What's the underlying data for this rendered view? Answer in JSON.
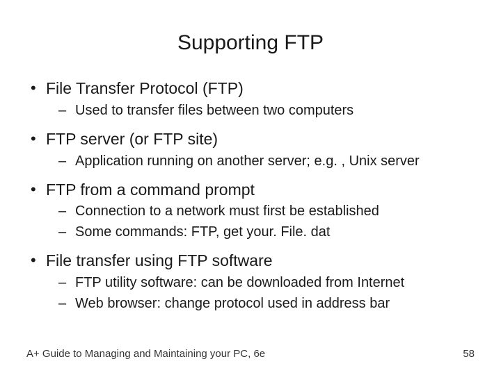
{
  "title": "Supporting FTP",
  "bullets": [
    {
      "text": "File Transfer Protocol (FTP)",
      "sub": [
        "Used to transfer files between two computers"
      ]
    },
    {
      "text": "FTP server (or FTP site)",
      "sub": [
        "Application running on another server; e.g. , Unix server"
      ]
    },
    {
      "text": "FTP from a command prompt",
      "sub": [
        "Connection to a network must first be established",
        "Some commands: FTP, get your. File. dat"
      ]
    },
    {
      "text": "File transfer using FTP software",
      "sub": [
        "FTP utility software: can be downloaded from Internet",
        "Web browser: change protocol used in address bar"
      ]
    }
  ],
  "footer_left": "A+ Guide to Managing and Maintaining your PC, 6e",
  "footer_right": "58"
}
